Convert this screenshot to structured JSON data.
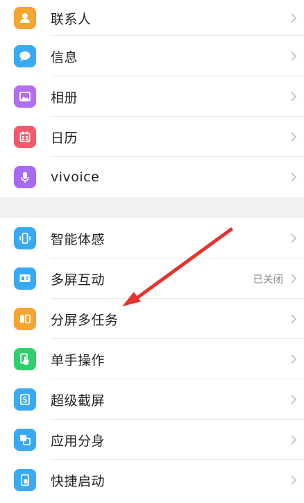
{
  "group1": [
    {
      "label": "联系人",
      "icon": "contacts-icon",
      "color": "#f7a531"
    },
    {
      "label": "信息",
      "icon": "message-icon",
      "color": "#3aa9f3"
    },
    {
      "label": "相册",
      "icon": "album-icon",
      "color": "#b36cf2"
    },
    {
      "label": "日历",
      "icon": "calendar-icon",
      "color": "#f3596a"
    },
    {
      "label": "vivoice",
      "icon": "microphone-icon",
      "color": "#a86af4"
    }
  ],
  "group2": [
    {
      "label": "智能体感",
      "icon": "motion-icon",
      "color": "#3aa9f3"
    },
    {
      "label": "多屏互动",
      "icon": "screen-share-icon",
      "color": "#3aa9f3",
      "status": "已关闭"
    },
    {
      "label": "分屏多任务",
      "icon": "split-screen-icon",
      "color": "#f7a531"
    },
    {
      "label": "单手操作",
      "icon": "one-hand-icon",
      "color": "#2fcf6d"
    },
    {
      "label": "超级截屏",
      "icon": "screenshot-icon",
      "color": "#3aa9f3"
    },
    {
      "label": "应用分身",
      "icon": "app-clone-icon",
      "color": "#3aa9f3"
    },
    {
      "label": "快捷启动",
      "icon": "quick-launch-icon",
      "color": "#3aa9f3"
    }
  ],
  "colors": {
    "annotation_arrow": "#e8322e"
  }
}
